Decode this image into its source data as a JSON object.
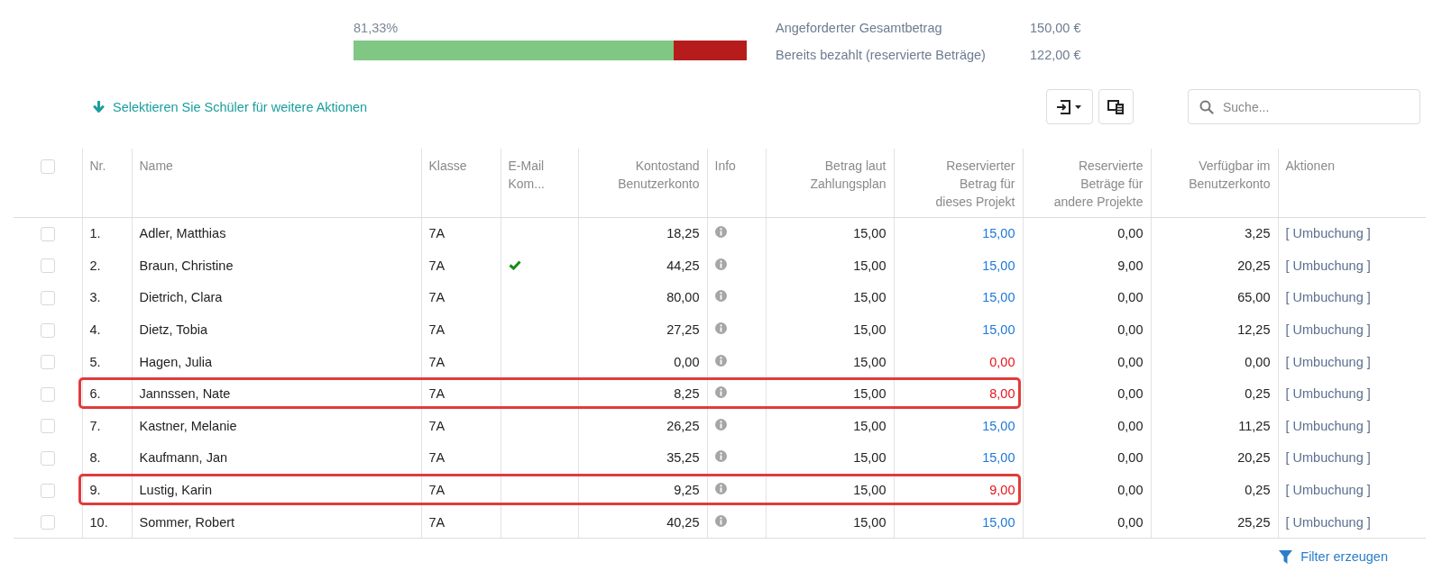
{
  "summary": {
    "percent": "81,33%",
    "level": 0.8133,
    "lines": [
      {
        "label": "Angeforderter Gesamtbetrag",
        "value": "150,00 €"
      },
      {
        "label": "Bereits bezahlt (reservierte Beträge)",
        "value": "122,00 €"
      }
    ]
  },
  "select_hint": "Selektieren Sie Schüler für weitere Aktionen",
  "search": {
    "placeholder": "Suche..."
  },
  "table": {
    "all_checked": false,
    "columns": [
      "Nr.",
      "Name",
      "Klasse",
      "E-Mail Kom...",
      "Kontostand Benutzerkonto",
      "Info",
      "Betrag laut Zahlungsplan",
      "Reservierter Betrag für dieses Projekt",
      "Reservierte Beträge für andere Projekte",
      "Verfügbar im Benutzerkonto",
      "Aktionen"
    ],
    "rows": [
      {
        "checked": false,
        "nr": "1.",
        "name": "Adler, Matthias",
        "klasse": "7A",
        "email": false,
        "konto": "18,25",
        "plan": "15,00",
        "reserved": "15,00",
        "short": false,
        "other": "0,00",
        "available": "3,25",
        "action": "[ Umbuchung ]",
        "highlighted": false
      },
      {
        "checked": false,
        "nr": "2.",
        "name": "Braun, Christine",
        "klasse": "7A",
        "email": true,
        "konto": "44,25",
        "plan": "15,00",
        "reserved": "15,00",
        "short": false,
        "other": "9,00",
        "available": "20,25",
        "action": "[ Umbuchung ]",
        "highlighted": false
      },
      {
        "checked": false,
        "nr": "3.",
        "name": "Dietrich, Clara",
        "klasse": "7A",
        "email": false,
        "konto": "80,00",
        "plan": "15,00",
        "reserved": "15,00",
        "short": false,
        "other": "0,00",
        "available": "65,00",
        "action": "[ Umbuchung ]",
        "highlighted": false
      },
      {
        "checked": false,
        "nr": "4.",
        "name": "Dietz, Tobia",
        "klasse": "7A",
        "email": false,
        "konto": "27,25",
        "plan": "15,00",
        "reserved": "15,00",
        "short": false,
        "other": "0,00",
        "available": "12,25",
        "action": "[ Umbuchung ]",
        "highlighted": false
      },
      {
        "checked": false,
        "nr": "5.",
        "name": "Hagen, Julia",
        "klasse": "7A",
        "email": false,
        "konto": "0,00",
        "plan": "15,00",
        "reserved": "0,00",
        "short": true,
        "other": "0,00",
        "available": "0,00",
        "action": "[ Umbuchung ]",
        "highlighted": false
      },
      {
        "checked": false,
        "nr": "6.",
        "name": "Jannssen, Nate",
        "klasse": "7A",
        "email": false,
        "konto": "8,25",
        "plan": "15,00",
        "reserved": "8,00",
        "short": true,
        "other": "0,00",
        "available": "0,25",
        "action": "[ Umbuchung ]",
        "highlighted": true
      },
      {
        "checked": false,
        "nr": "7.",
        "name": "Kastner, Melanie",
        "klasse": "7A",
        "email": false,
        "konto": "26,25",
        "plan": "15,00",
        "reserved": "15,00",
        "short": false,
        "other": "0,00",
        "available": "11,25",
        "action": "[ Umbuchung ]",
        "highlighted": false
      },
      {
        "checked": false,
        "nr": "8.",
        "name": "Kaufmann, Jan",
        "klasse": "7A",
        "email": false,
        "konto": "35,25",
        "plan": "15,00",
        "reserved": "15,00",
        "short": false,
        "other": "0,00",
        "available": "20,25",
        "action": "[ Umbuchung ]",
        "highlighted": false
      },
      {
        "checked": false,
        "nr": "9.",
        "name": "Lustig, Karin",
        "klasse": "7A",
        "email": false,
        "konto": "9,25",
        "plan": "15,00",
        "reserved": "9,00",
        "short": true,
        "other": "0,00",
        "available": "0,25",
        "action": "[ Umbuchung ]",
        "highlighted": true
      },
      {
        "checked": false,
        "nr": "10.",
        "name": "Sommer, Robert",
        "klasse": "7A",
        "email": false,
        "konto": "40,25",
        "plan": "15,00",
        "reserved": "15,00",
        "short": false,
        "other": "0,00",
        "available": "25,25",
        "action": "[ Umbuchung ]",
        "highlighted": false
      }
    ]
  },
  "filter_link": "Filter erzeugen"
}
